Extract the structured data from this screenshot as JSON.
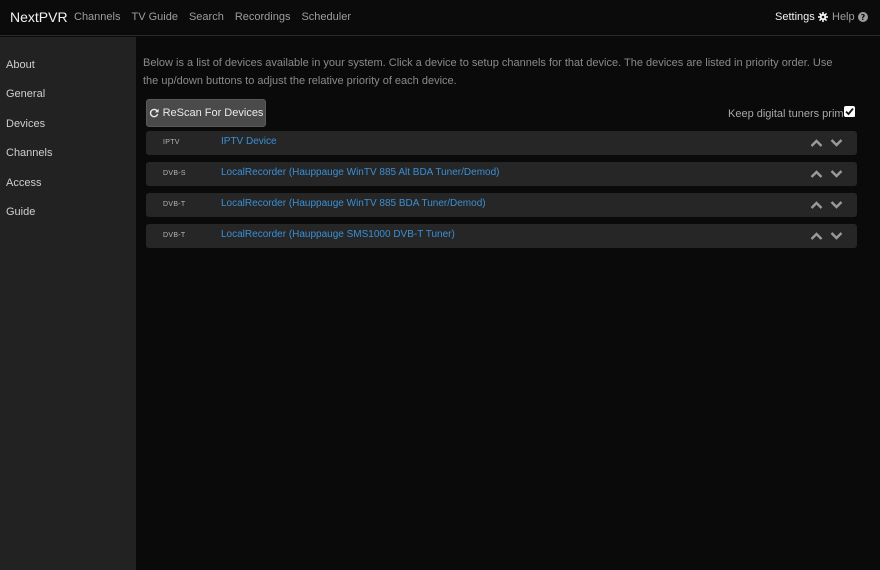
{
  "app": {
    "brand": "NextPVR",
    "nav": [
      "Channels",
      "TV Guide",
      "Search",
      "Recordings",
      "Scheduler"
    ],
    "settings_label": "Settings",
    "help_label": "Help"
  },
  "sidebar": {
    "items": [
      "About",
      "General",
      "Devices",
      "Channels",
      "Access",
      "Guide"
    ]
  },
  "main": {
    "intro": "Below is a list of devices available in your system. Click a device to setup channels for that device. The devices are listed in priority order. Use the up/down buttons to adjust the relative priority of each device.",
    "rescan_label": "ReScan For Devices",
    "keep_primed_label": "Keep digital tuners primed",
    "keep_primed_checked": true,
    "devices": [
      {
        "type": "IPTV",
        "name": "IPTV Device"
      },
      {
        "type": "DVB-S",
        "name": "LocalRecorder (Hauppauge WinTV 885 Alt BDA Tuner/Demod)"
      },
      {
        "type": "DVB-T",
        "name": "LocalRecorder (Hauppauge WinTV 885 BDA Tuner/Demod)"
      },
      {
        "type": "DVB-T",
        "name": "LocalRecorder (Hauppauge SMS1000 DVB-T Tuner)"
      }
    ]
  },
  "colors": {
    "accent_link": "#3a8fd6",
    "sidebar_bg": "#222222",
    "row_bg": "#262626"
  }
}
